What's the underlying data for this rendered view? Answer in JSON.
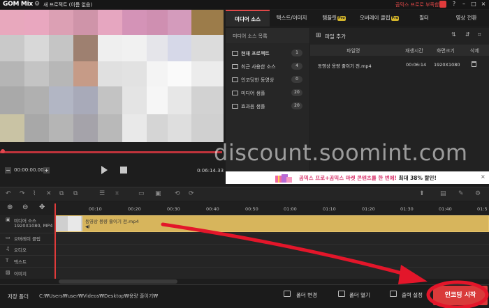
{
  "titlebar": {
    "logo": "GOM Mix",
    "project_title": "새 프로젝트 (이름 없음)",
    "promo_link": "곰믹스 프로로 부족함 끝!",
    "help": "?",
    "minimize": "–",
    "maximize": "□",
    "close": "×"
  },
  "player": {
    "current_time": "00:00:00.00",
    "total_time": "0:06:14.33",
    "minus": "−",
    "plus": "+",
    "progress_fraction": 0.0
  },
  "tabs": [
    {
      "label": "미디어 소스",
      "active": true,
      "pro": false
    },
    {
      "label": "텍스트/이미지",
      "active": false,
      "pro": false
    },
    {
      "label": "템플릿",
      "active": false,
      "pro": true
    },
    {
      "label": "오버레이 클립",
      "active": false,
      "pro": true
    },
    {
      "label": "필터",
      "active": false,
      "pro": false
    },
    {
      "label": "영상 전환",
      "active": false,
      "pro": false
    }
  ],
  "pro_badge": "Pro",
  "media_source": {
    "list_title": "미디어 소스 목록",
    "folders": [
      {
        "name": "현재 프로젝트",
        "count": "1"
      },
      {
        "name": "최근 사용한 소스",
        "count": "4"
      },
      {
        "name": "인코딩한 동영상",
        "count": "0"
      },
      {
        "name": "미디어 샘플",
        "count": "20"
      },
      {
        "name": "효과음 샘플",
        "count": "20"
      }
    ],
    "add_file": "파일 추가",
    "columns": [
      "파일명",
      "재생시간",
      "화면크기",
      "삭제"
    ],
    "files": [
      {
        "name": "동영상 용량 줄이기 전.mp4",
        "duration": "00:06:14",
        "size": "1920X1080"
      }
    ]
  },
  "ad": {
    "text_pre": "곰믹스 프로+곰믹스 마켓 콘텐츠를 한 번에! ",
    "text_highlight": "최대 38% 할인!",
    "close": "×"
  },
  "watermark": "discount.soomint.com",
  "timeline": {
    "ticks": [
      "00:10",
      "00:20",
      "00:30",
      "00:40",
      "00:50",
      "01:00",
      "01:10",
      "01:20",
      "01:30",
      "01:40",
      "01:5"
    ],
    "tracks": [
      {
        "label": "미디어 소스",
        "sub": "1920X1080, MP4"
      },
      {
        "label": "오버레이 클립",
        "sub": ""
      },
      {
        "label": "오디오",
        "sub": ""
      },
      {
        "label": "텍스트",
        "sub": ""
      },
      {
        "label": "이미지",
        "sub": ""
      }
    ],
    "clip_label": "동영상 용량 줄이기 전.mp4"
  },
  "bottom": {
    "save_label": "저장 폴더",
    "save_path": "C:₩Users₩user₩Videos₩Desktop₩용량 줄이기₩",
    "change_folder": "폴더 변경",
    "open_folder": "폴더 열기",
    "output_settings": "출력 설정",
    "encode": "인코딩 시작"
  },
  "colors": {
    "accent": "#d93a3a",
    "clip": "#d7b55c",
    "pro_badge": "#d4b52a"
  }
}
